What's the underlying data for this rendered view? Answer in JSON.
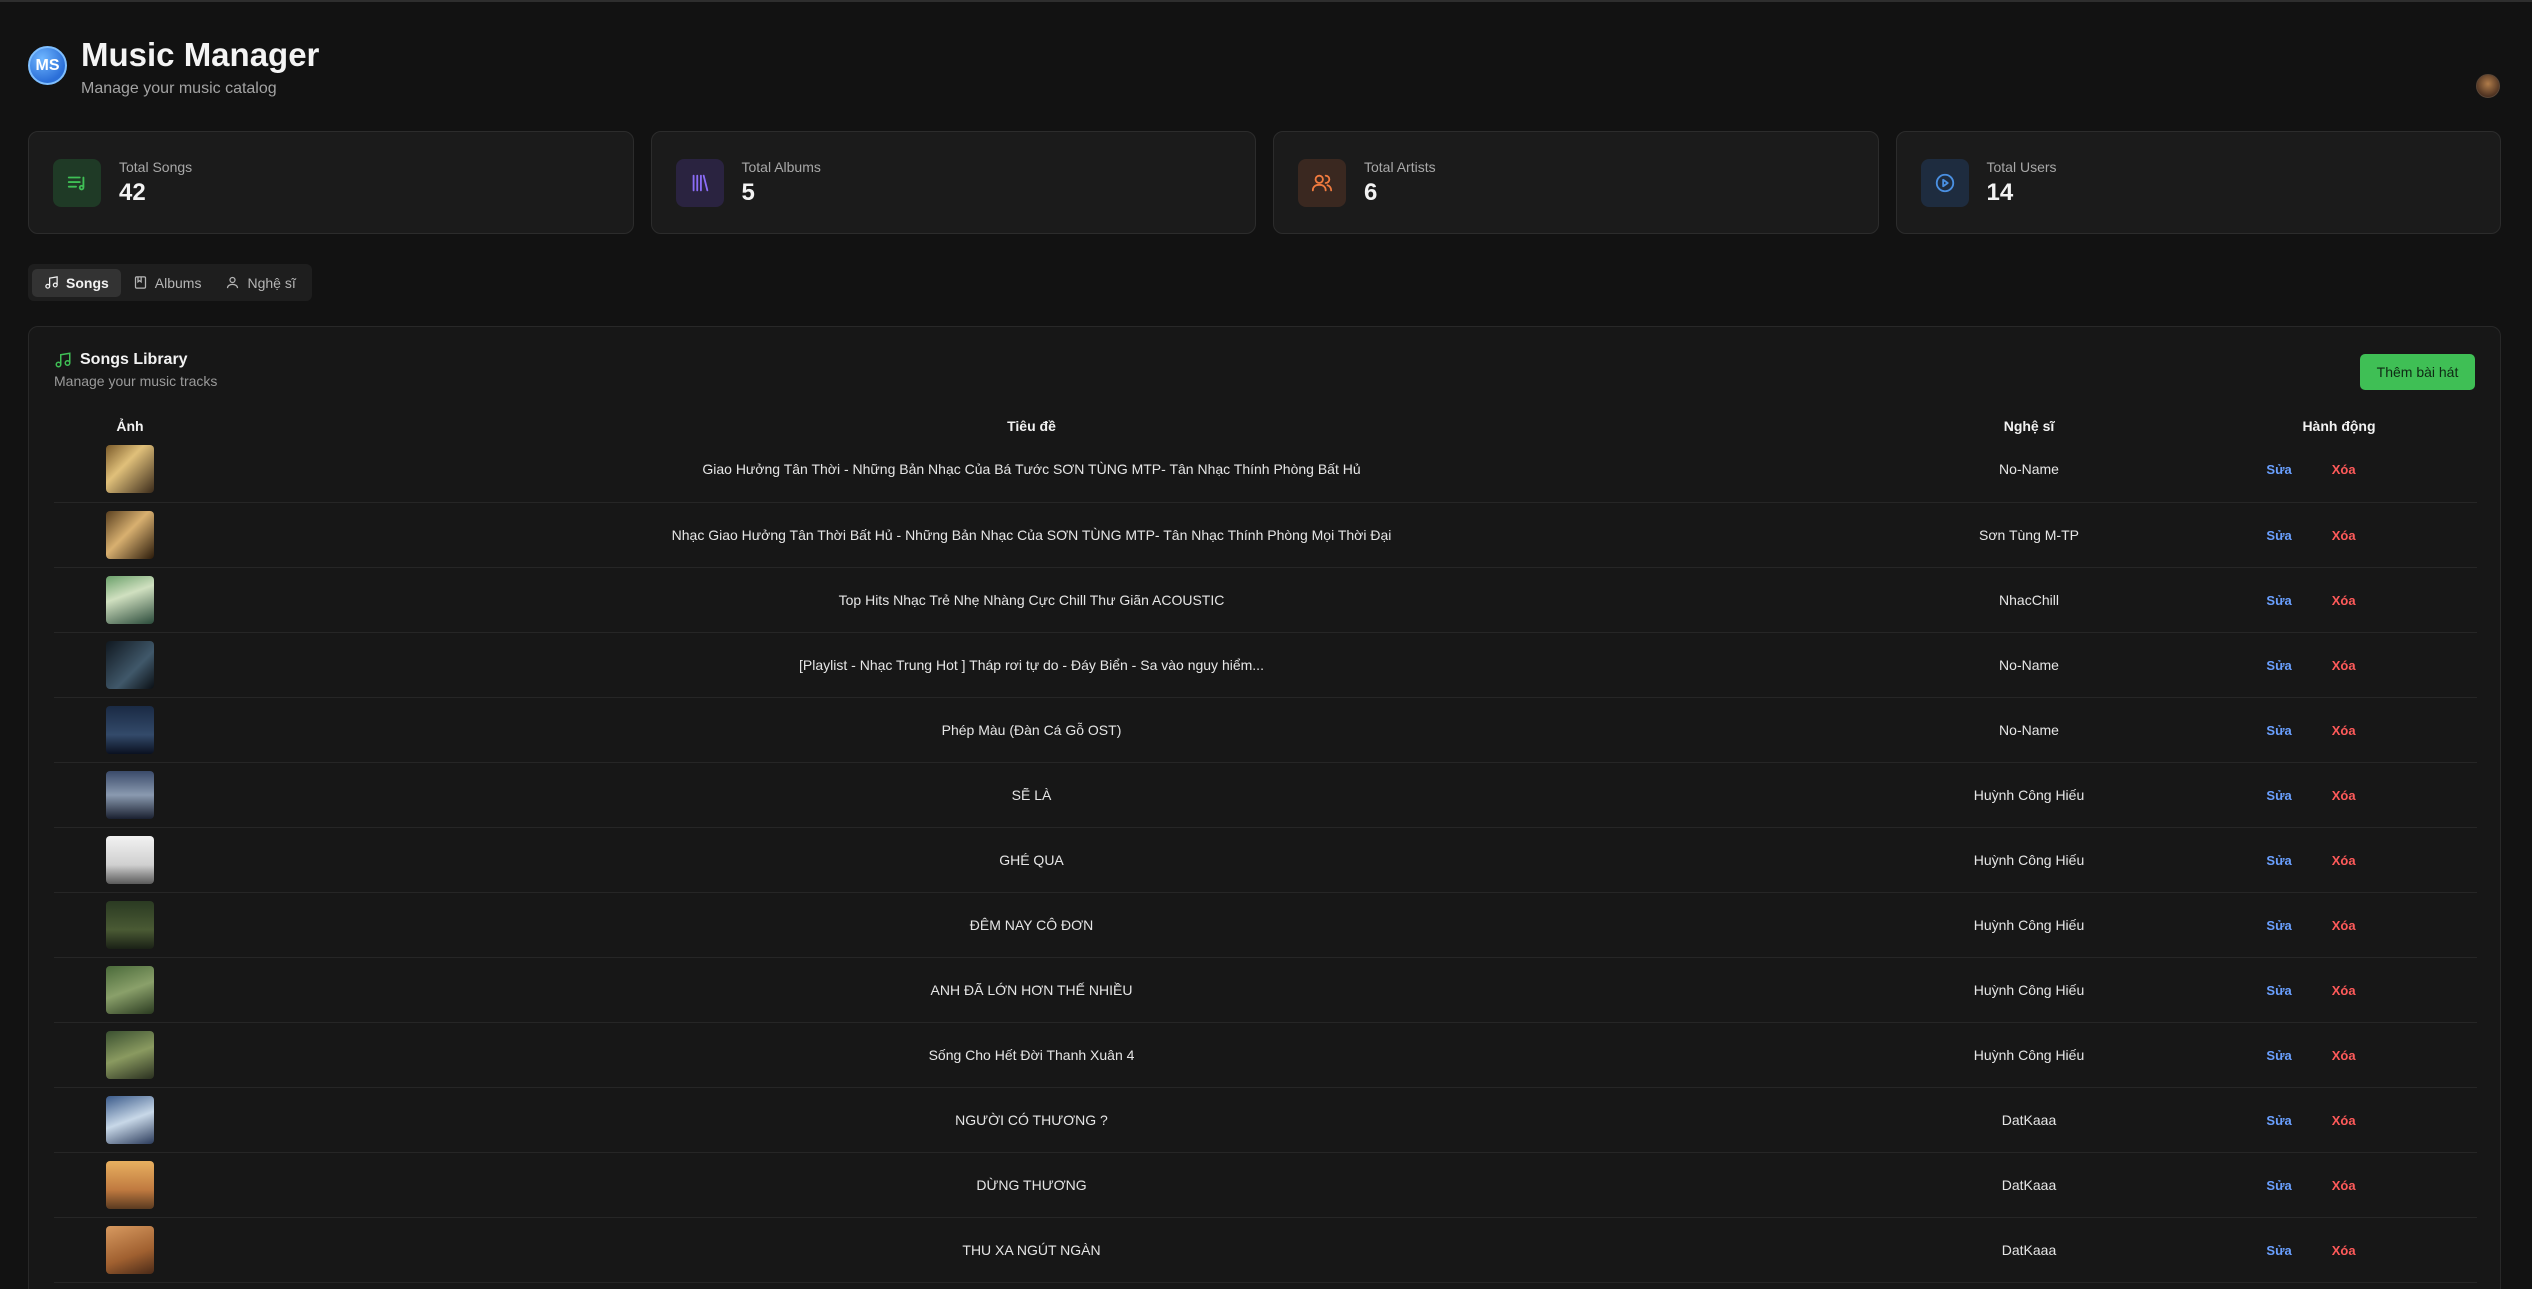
{
  "header": {
    "logo_text": "MS",
    "title": "Music Manager",
    "subtitle": "Manage your music catalog"
  },
  "stats": [
    {
      "label": "Total Songs",
      "value": "42",
      "icon": "music-list-icon",
      "color": "#3fbf55"
    },
    {
      "label": "Total Albums",
      "value": "5",
      "icon": "library-icon",
      "color": "#8b6cf6"
    },
    {
      "label": "Total Artists",
      "value": "6",
      "icon": "users-icon",
      "color": "#f07b3f"
    },
    {
      "label": "Total Users",
      "value": "14",
      "icon": "play-circle-icon",
      "color": "#4a90e2"
    }
  ],
  "tabs": [
    {
      "label": "Songs",
      "icon": "music-note-icon",
      "active": true
    },
    {
      "label": "Albums",
      "icon": "album-icon",
      "active": false
    },
    {
      "label": "Nghệ sĩ",
      "icon": "user-icon",
      "active": false
    }
  ],
  "library": {
    "title": "Songs Library",
    "subtitle": "Manage your music tracks",
    "add_label": "Thêm bài hát",
    "columns": [
      "Ảnh",
      "Tiêu đề",
      "Nghệ sĩ",
      "Hành động"
    ],
    "edit_label": "Sửa",
    "delete_label": "Xóa",
    "rows": [
      {
        "title": "Giao Hưởng Tân Thời - Những Bản Nhạc Của Bá Tước SƠN TÙNG MTP- Tân Nhạc Thính Phòng Bất Hủ",
        "artist": "No-Name"
      },
      {
        "title": "Nhạc Giao Hưởng Tân Thời Bất Hủ - Những Bản Nhạc Của SƠN TÙNG MTP- Tân Nhạc Thính Phòng Mọi Thời Đại",
        "artist": "Sơn Tùng M-TP"
      },
      {
        "title": "Top Hits Nhạc Trẻ Nhẹ Nhàng Cực Chill Thư Giãn ACOUSTIC",
        "artist": "NhacChill"
      },
      {
        "title": "[Playlist - Nhạc Trung Hot ] Tháp rơi tự do - Đáy Biển - Sa vào nguy hiểm...",
        "artist": "No-Name"
      },
      {
        "title": "Phép Màu (Đàn Cá Gỗ OST)",
        "artist": "No-Name"
      },
      {
        "title": "SẼ LÀ",
        "artist": "Huỳnh Công Hiếu"
      },
      {
        "title": "GHÉ QUA",
        "artist": "Huỳnh Công Hiếu"
      },
      {
        "title": "ĐÊM NAY CÔ ĐƠN",
        "artist": "Huỳnh Công Hiếu"
      },
      {
        "title": "ANH ĐÃ LỚN HƠN THẾ NHIỀU",
        "artist": "Huỳnh Công Hiếu"
      },
      {
        "title": "Sống Cho Hết Đời Thanh Xuân 4",
        "artist": "Huỳnh Công Hiếu"
      },
      {
        "title": "NGƯỜI CÓ THƯƠNG ?",
        "artist": "DatKaaa"
      },
      {
        "title": "DỪNG THƯƠNG",
        "artist": "DatKaaa"
      },
      {
        "title": "THU XA NGÚT NGÀN",
        "artist": "DatKaaa"
      }
    ]
  }
}
